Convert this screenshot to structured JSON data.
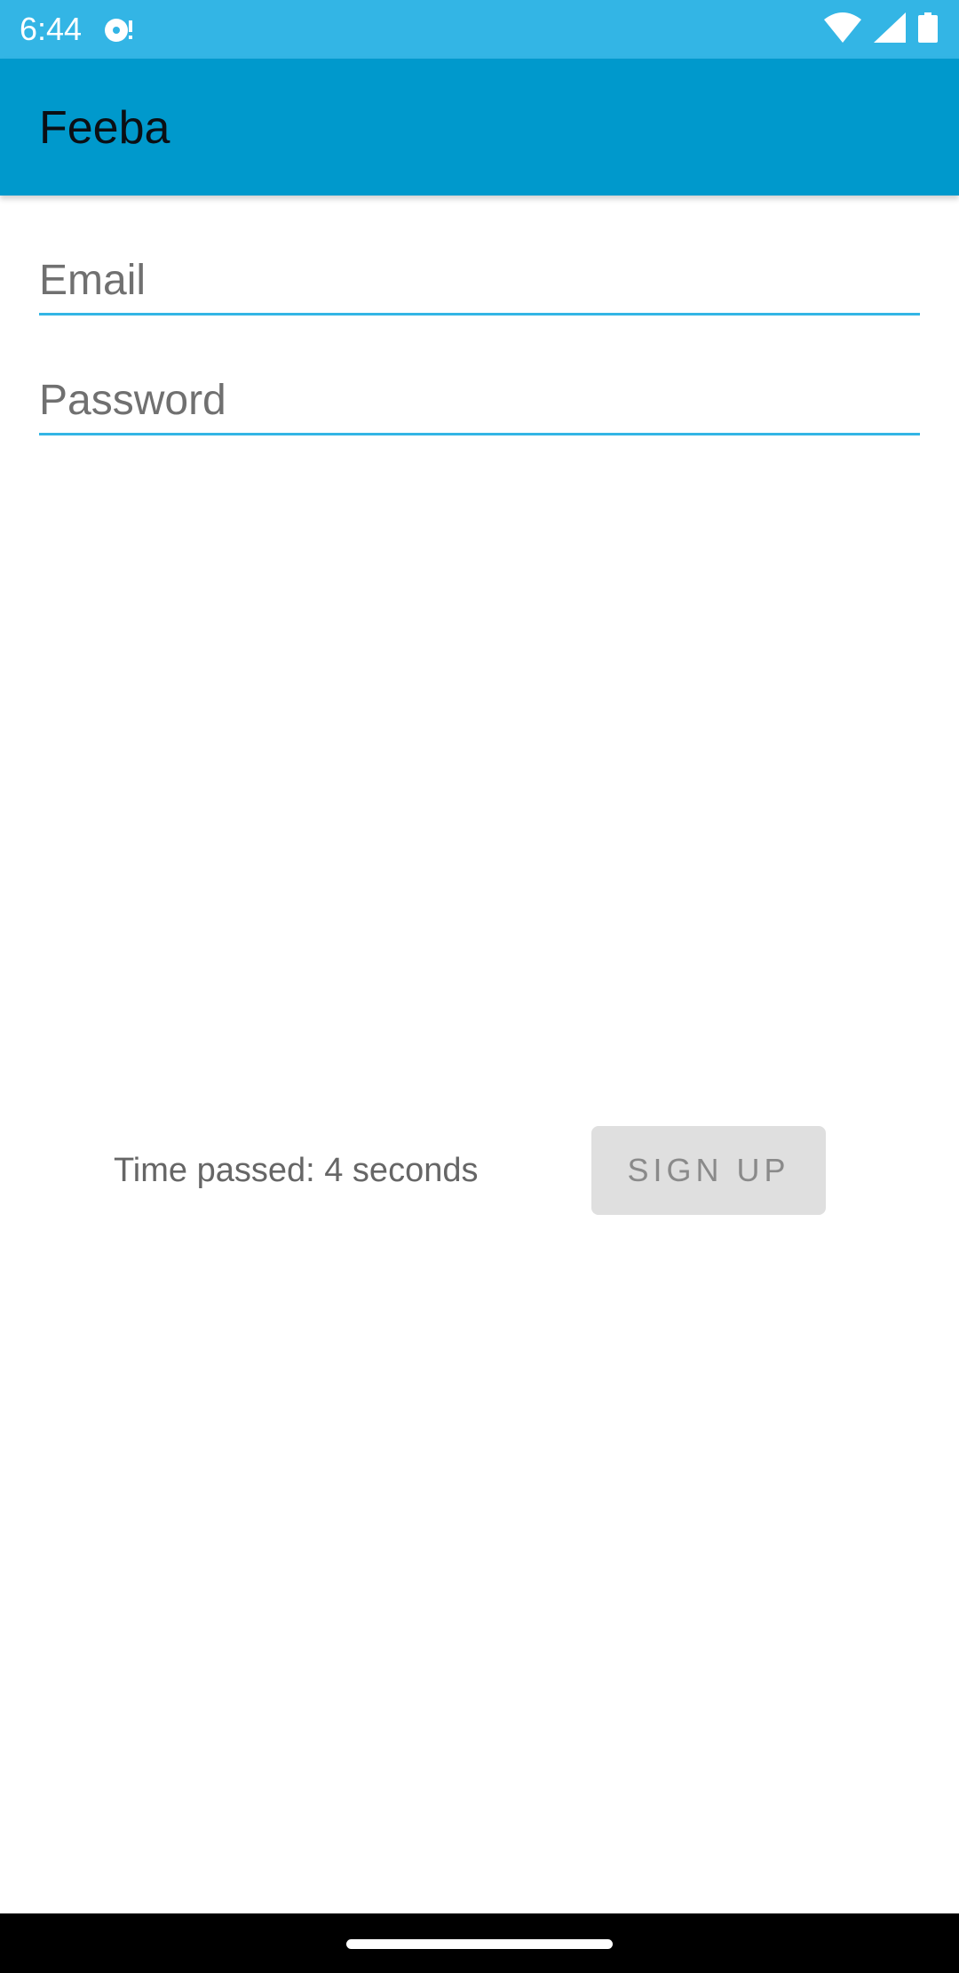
{
  "status_bar": {
    "time": "6:44",
    "background_color": "#33b5e5",
    "icons": [
      "notification-icon",
      "wifi-icon",
      "signal-icon",
      "battery-icon"
    ]
  },
  "app_bar": {
    "title": "Feeba",
    "background_color": "#0099cc"
  },
  "form": {
    "email_placeholder": "Email",
    "email_value": "",
    "password_placeholder": "Password",
    "password_value": "",
    "underline_color": "#33b5e5"
  },
  "footer_row": {
    "timer_text": "Time passed: 4 seconds",
    "signup_label": "SIGN UP"
  },
  "nav_bar": {
    "background_color": "#000000"
  }
}
